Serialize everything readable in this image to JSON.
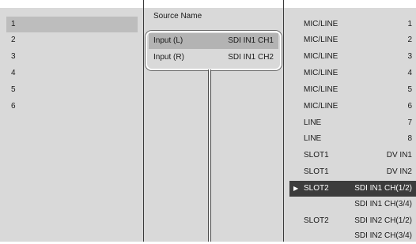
{
  "sources": [
    "1",
    "2",
    "3",
    "4",
    "5",
    "6"
  ],
  "middle": {
    "title": "Source Name",
    "rows": [
      {
        "name": "Input (L)",
        "value": "SDI IN1 CH1"
      },
      {
        "name": "Input (R)",
        "value": "SDI IN1 CH2"
      }
    ]
  },
  "options": [
    {
      "type": "MIC/LINE",
      "value": "1"
    },
    {
      "type": "MIC/LINE",
      "value": "2"
    },
    {
      "type": "MIC/LINE",
      "value": "3"
    },
    {
      "type": "MIC/LINE",
      "value": "4"
    },
    {
      "type": "MIC/LINE",
      "value": "5"
    },
    {
      "type": "MIC/LINE",
      "value": "6"
    },
    {
      "type": "LINE",
      "value": "7"
    },
    {
      "type": "LINE",
      "value": "8"
    },
    {
      "type": "SLOT1",
      "value": "DV IN1"
    },
    {
      "type": "SLOT1",
      "value": "DV IN2"
    },
    {
      "type": "SLOT2",
      "value": "SDI IN1 CH(1/2)"
    },
    {
      "type": "",
      "value": "SDI IN1 CH(3/4)"
    },
    {
      "type": "SLOT2",
      "value": "SDI IN2 CH(1/2)"
    },
    {
      "type": "",
      "value": "SDI IN2 CH(3/4)"
    }
  ],
  "selected_marker": "▶",
  "colors": {
    "panel": "#d9d9d9",
    "selection_light": "#bdbdbd",
    "selection_dark": "#3c3c3c"
  }
}
